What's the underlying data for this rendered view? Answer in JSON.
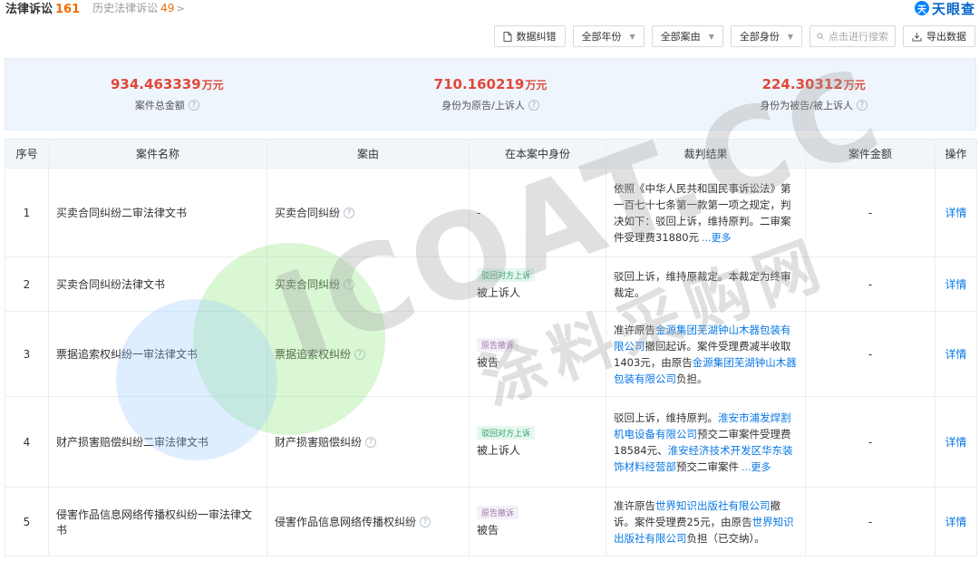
{
  "tabs": {
    "active_label": "法律诉讼",
    "active_count": "161",
    "history_label": "历史法律诉讼",
    "history_count": "49",
    "history_chevron": ">"
  },
  "logo": {
    "mark": "天",
    "text": "天眼查"
  },
  "toolbar": {
    "correction": "数据纠错",
    "year_filter": "全部年份",
    "cause_filter": "全部案由",
    "role_filter": "全部身份",
    "search_placeholder": "点击进行搜索",
    "export": "导出数据"
  },
  "summary": [
    {
      "value": "934.463339",
      "unit": "万元",
      "label": "案件总金额"
    },
    {
      "value": "710.160219",
      "unit": "万元",
      "label": "身份为原告/上诉人"
    },
    {
      "value": "224.30312",
      "unit": "万元",
      "label": "身份为被告/被上诉人"
    }
  ],
  "table": {
    "headers": [
      "序号",
      "案件名称",
      "案由",
      "在本案中身份",
      "裁判结果",
      "案件金额",
      "操作"
    ],
    "rows": [
      {
        "index": "1",
        "name": "买卖合同纠纷二审法律文书",
        "cause": "买卖合同纠纷",
        "role_tag": "",
        "role": "-",
        "result_parts": [
          {
            "t": "依照《中华人民共和国民事诉讼法》第一百七十七条第一款第一项之规定，判决如下：驳回上诉，维持原判。二审案件受理费31880元",
            "link": false
          }
        ],
        "more": "...更多",
        "amount": "-",
        "action": "详情"
      },
      {
        "index": "2",
        "name": "买卖合同纠纷法律文书",
        "cause": "买卖合同纠纷",
        "role_tag": "驳回对方上诉",
        "role": "被上诉人",
        "result_parts": [
          {
            "t": "驳回上诉，维持原裁定。本裁定为终审裁定。",
            "link": false
          }
        ],
        "more": "",
        "amount": "-",
        "action": "详情"
      },
      {
        "index": "3",
        "name": "票据追索权纠纷一审法律文书",
        "cause": "票据追索权纠纷",
        "role_tag": "原告撤诉",
        "role": "被告",
        "result_parts": [
          {
            "t": "准许原告",
            "link": false
          },
          {
            "t": "金源集团芜湖钟山木器包装有限公司",
            "link": true
          },
          {
            "t": "撤回起诉。案件受理费减半收取1403元，由原告",
            "link": false
          },
          {
            "t": "金源集团芜湖钟山木器包装有限公司",
            "link": true
          },
          {
            "t": "负担。",
            "link": false
          }
        ],
        "more": "",
        "amount": "-",
        "action": "详情"
      },
      {
        "index": "4",
        "name": "财产损害赔偿纠纷二审法律文书",
        "cause": "财产损害赔偿纠纷",
        "role_tag": "驳回对方上诉",
        "role": "被上诉人",
        "result_parts": [
          {
            "t": "驳回上诉，维持原判。",
            "link": false
          },
          {
            "t": "淮安市浦发焊割机电设备有限公司",
            "link": true
          },
          {
            "t": "预交二审案件受理费18584元、",
            "link": false
          },
          {
            "t": "淮安经济技术开发区华东装饰材料经营部",
            "link": true
          },
          {
            "t": "预交二审案件",
            "link": false
          }
        ],
        "more": "...更多",
        "amount": "-",
        "action": "详情"
      },
      {
        "index": "5",
        "name": "侵害作品信息网络传播权纠纷一审法律文书",
        "cause": "侵害作品信息网络传播权纠纷",
        "role_tag": "原告撤诉",
        "role": "被告",
        "result_parts": [
          {
            "t": "准许原告",
            "link": false
          },
          {
            "t": "世界知识出版社有限公司",
            "link": true
          },
          {
            "t": "撤诉。案件受理费25元，由原告",
            "link": false
          },
          {
            "t": "世界知识出版社有限公司",
            "link": true
          },
          {
            "t": "负担（已交纳）。",
            "link": false
          }
        ],
        "more": "",
        "amount": "-",
        "action": "详情"
      }
    ]
  },
  "watermark": {
    "latin": "ICOAT.CC",
    "cn": "涂料采购网"
  },
  "colors": {
    "accent_blue": "#0a78e6",
    "amount_red": "#e0483b",
    "count_orange": "#f56c00"
  }
}
